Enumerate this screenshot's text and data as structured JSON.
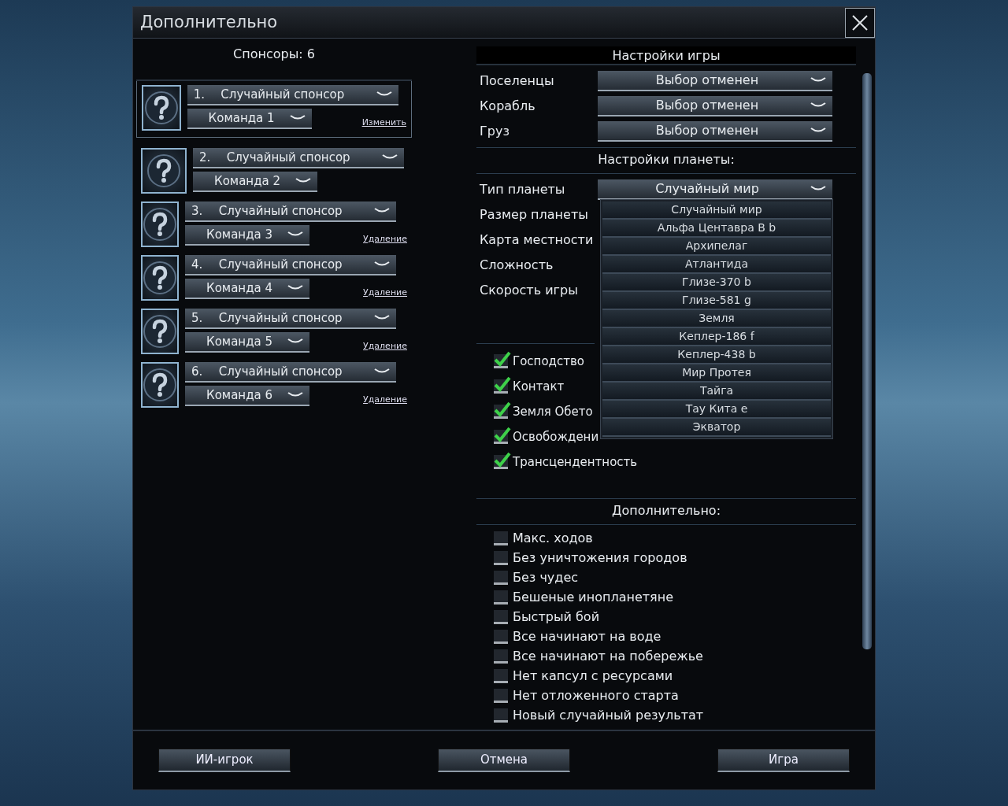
{
  "window": {
    "title": "Дополнительно"
  },
  "sponsors": {
    "title": "Спонсоры: 6",
    "items": [
      {
        "number": "1.",
        "name": "Случайный спонсор",
        "team": "Команда 1",
        "action": "Изменить",
        "selected": true
      },
      {
        "number": "2.",
        "name": "Случайный спонсор",
        "team": "Команда 2",
        "selected": false
      },
      {
        "number": "3.",
        "name": "Случайный спонсор",
        "team": "Команда 3",
        "action": "Удаление",
        "selected": false
      },
      {
        "number": "4.",
        "name": "Случайный спонсор",
        "team": "Команда 4",
        "action": "Удаление",
        "selected": false
      },
      {
        "number": "5.",
        "name": "Случайный спонсор",
        "team": "Команда 5",
        "action": "Удаление",
        "selected": false
      },
      {
        "number": "6.",
        "name": "Случайный спонсор",
        "team": "Команда 6",
        "action": "Удаление",
        "selected": false
      }
    ]
  },
  "game_settings": {
    "title": "Настройки игры",
    "rows": [
      {
        "label": "Поселенцы",
        "value": "Выбор отменен"
      },
      {
        "label": "Корабль",
        "value": "Выбор отменен"
      },
      {
        "label": "Груз",
        "value": "Выбор отменен"
      }
    ]
  },
  "planet_settings": {
    "title": "Настройки планеты:",
    "rows": [
      {
        "label": "Тип планеты",
        "value": "Случайный мир",
        "expanded": true,
        "options": [
          "Случайный мир",
          "Альфа Центавра B b",
          "Архипелаг",
          "Атлантида",
          "Глизе-370 b",
          "Глизе-581 g",
          "Земля",
          "Кеплер-186 f",
          "Кеплер-438 b",
          "Мир Протея",
          "Тайга",
          "Тау Кита e",
          "Экватор"
        ]
      },
      {
        "label": "Размер планеты"
      },
      {
        "label": "Карта местности"
      },
      {
        "label": "Сложность"
      },
      {
        "label": "Скорость игры"
      }
    ]
  },
  "victories": [
    {
      "label": "Господство",
      "checked": true
    },
    {
      "label": "Контакт",
      "checked": true
    },
    {
      "label": "Земля Обето",
      "checked": true
    },
    {
      "label": "Освобождени",
      "checked": true
    },
    {
      "label": "Трансцендентность",
      "checked": true
    }
  ],
  "advanced": {
    "title": "Дополнительно:",
    "options": [
      {
        "label": "Макс. ходов",
        "checked": false
      },
      {
        "label": "Без уничтожения городов",
        "checked": false
      },
      {
        "label": "Без чудес",
        "checked": false
      },
      {
        "label": "Бешеные инопланетяне",
        "checked": false
      },
      {
        "label": "Быстрый бой",
        "checked": false
      },
      {
        "label": "Все начинают на воде",
        "checked": false
      },
      {
        "label": "Все начинают на побережье",
        "checked": false
      },
      {
        "label": "Нет капсул с ресурсами",
        "checked": false
      },
      {
        "label": "Нет отложенного старта",
        "checked": false
      },
      {
        "label": "Новый случайный результат",
        "checked": false
      }
    ]
  },
  "buttons": [
    "ИИ-игрок",
    "Отмена",
    "Игра"
  ]
}
